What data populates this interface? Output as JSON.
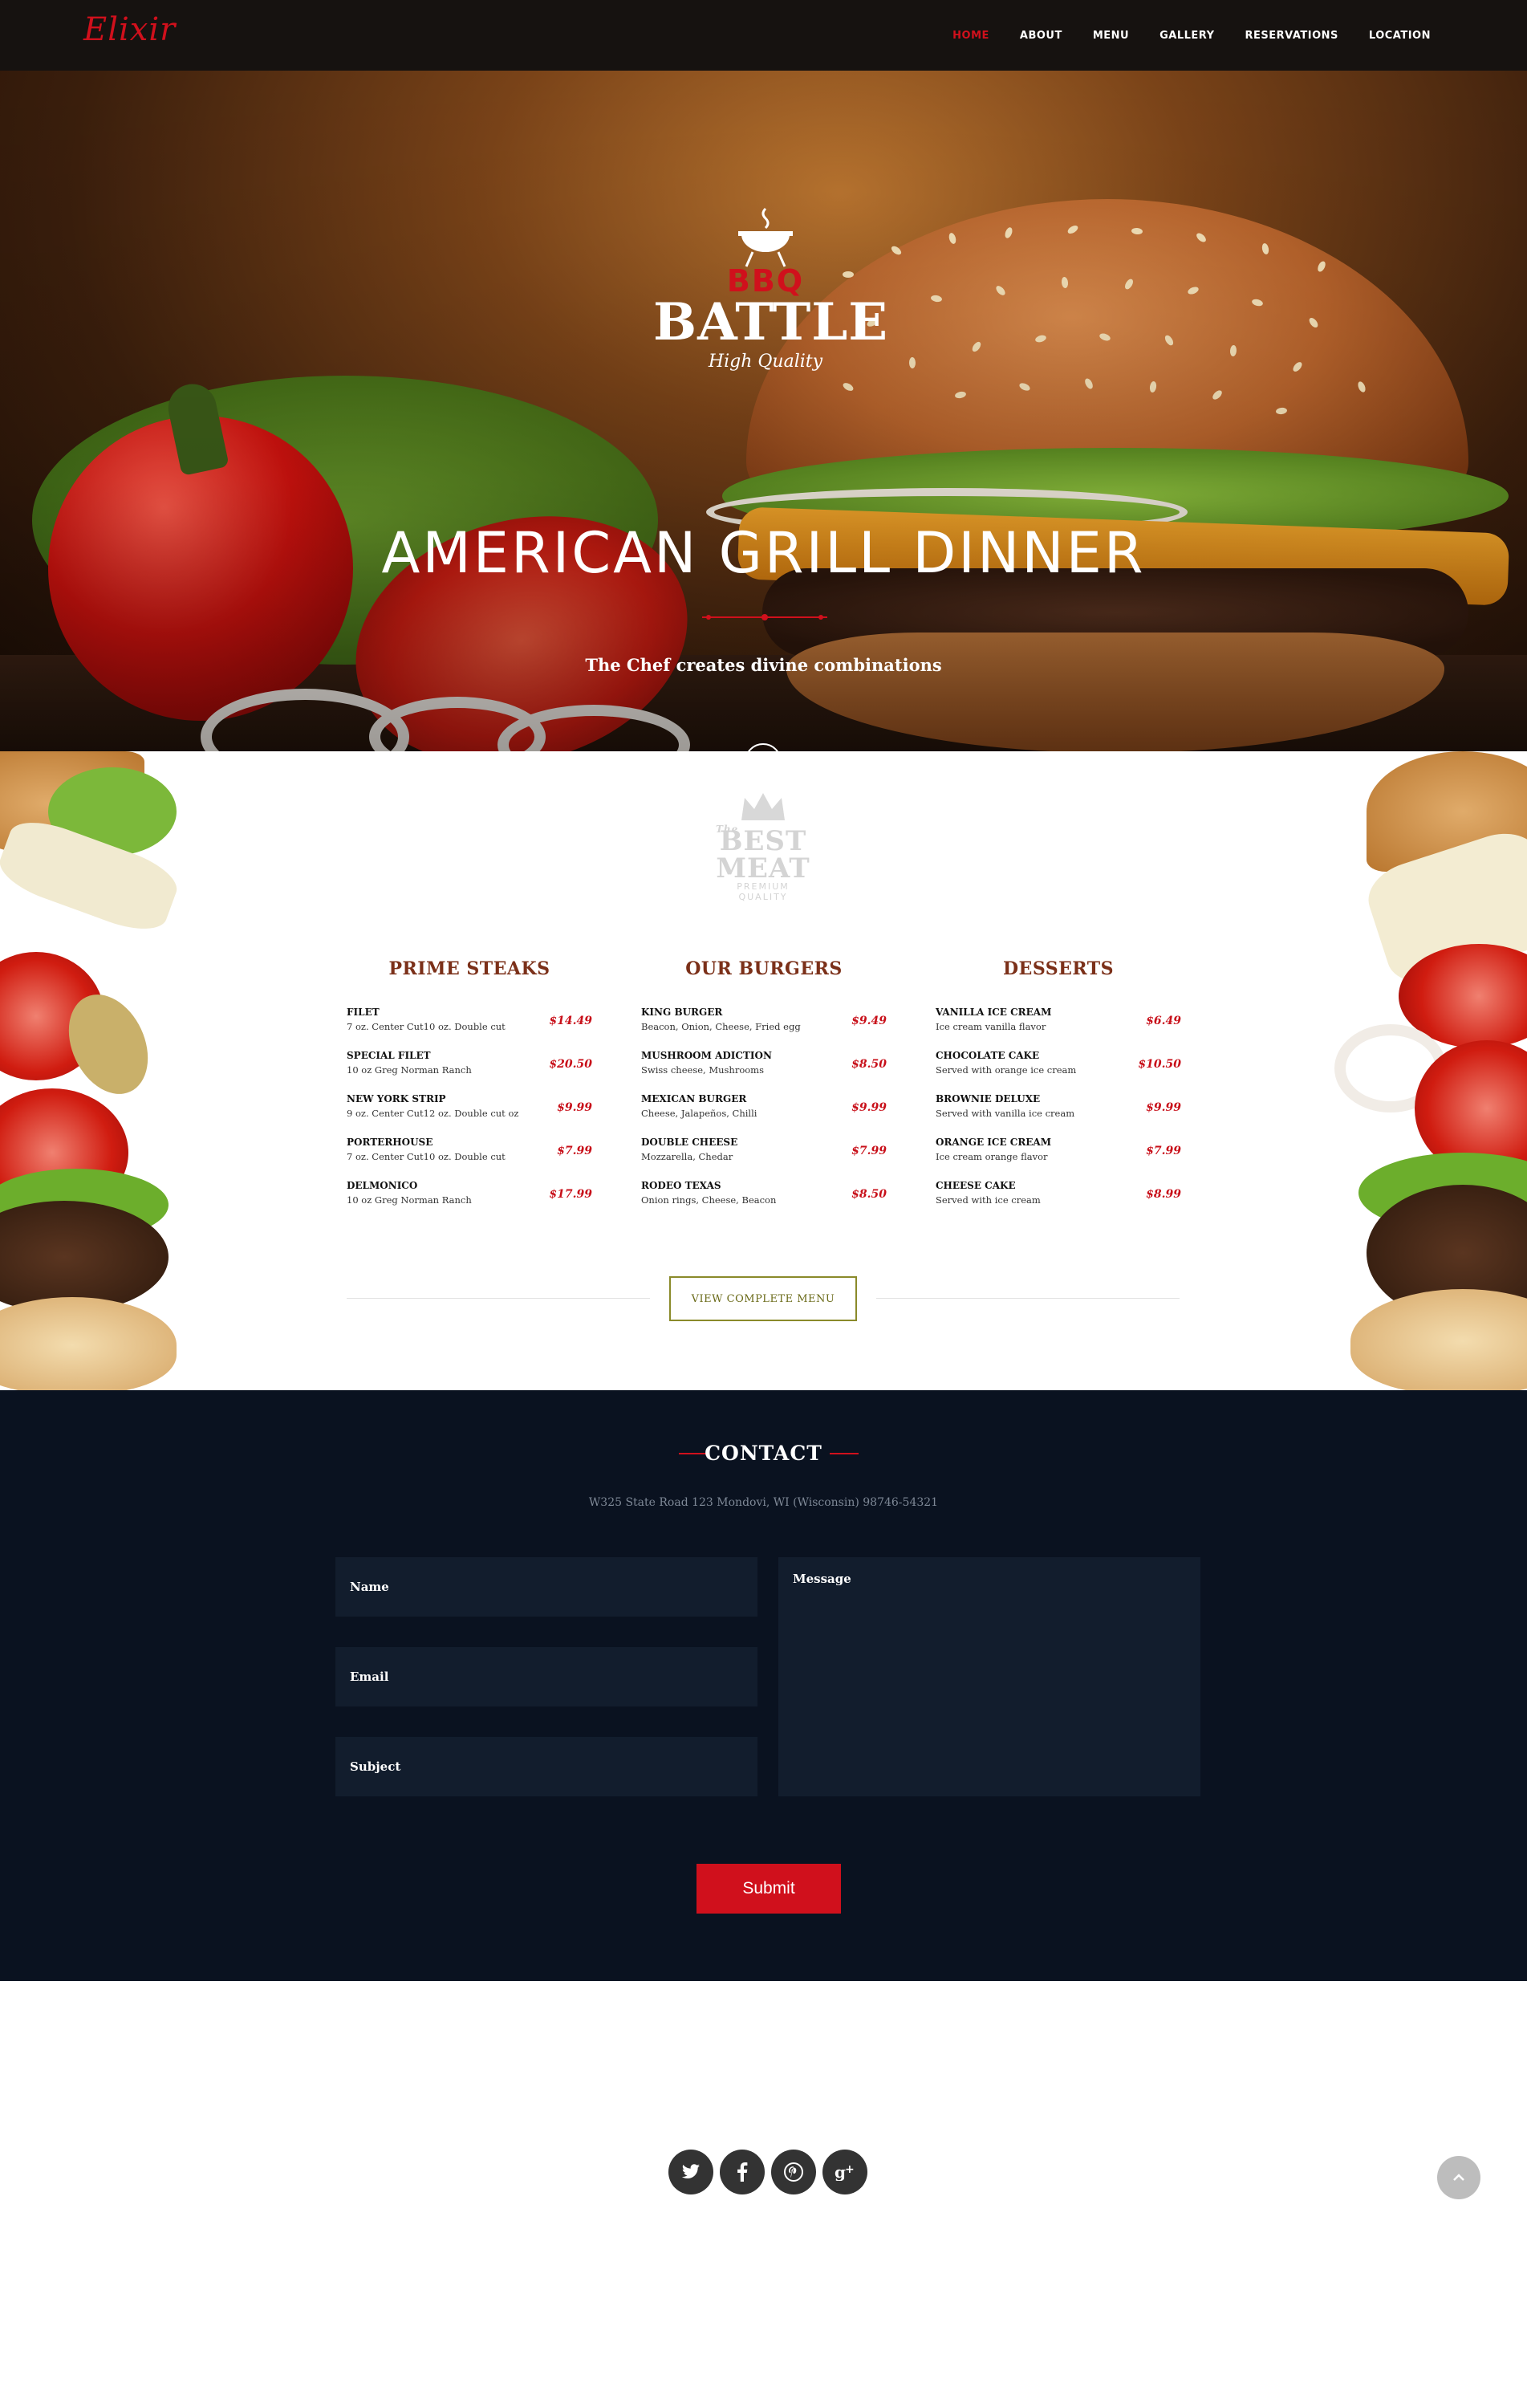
{
  "brand": {
    "logo": "Elixir",
    "accent": "#d0101c"
  },
  "nav": {
    "items": [
      {
        "label": "HOME",
        "active": true
      },
      {
        "label": "ABOUT"
      },
      {
        "label": "MENU"
      },
      {
        "label": "GALLERY"
      },
      {
        "label": "RESERVATIONS"
      },
      {
        "label": "LOCATION"
      }
    ]
  },
  "hero": {
    "badge_top": "BBQ",
    "badge_main": "BATTLE",
    "badge_tagline": "High Quality",
    "title": "AMERICAN GRILL DINNER",
    "subtitle": "The Chef creates divine combinations",
    "scroll_icon": "chevron-down-icon"
  },
  "menu": {
    "emblem": {
      "small_top": "The",
      "line1": "BEST",
      "line2": "MEAT",
      "small_bottom": "PREMIUM QUALITY"
    },
    "columns": [
      {
        "title": "PRIME STEAKS",
        "items": [
          {
            "name": "FILET",
            "desc": "7 oz. Center Cut10 oz. Double cut",
            "price": "$14.49"
          },
          {
            "name": "SPECIAL FILET",
            "desc": "10 oz Greg Norman Ranch",
            "price": "$20.50"
          },
          {
            "name": "NEW YORK STRIP",
            "desc": "9 oz. Center Cut12 oz. Double cut oz",
            "price": "$9.99"
          },
          {
            "name": "PORTERHOUSE",
            "desc": "7 oz. Center Cut10 oz. Double cut",
            "price": "$7.99"
          },
          {
            "name": "DELMONICO",
            "desc": "10 oz Greg Norman Ranch",
            "price": "$17.99"
          }
        ]
      },
      {
        "title": "OUR BURGERS",
        "items": [
          {
            "name": "KING BURGER",
            "desc": "Beacon, Onion, Cheese, Fried egg",
            "price": "$9.49"
          },
          {
            "name": "MUSHROOM ADICTION",
            "desc": "Swiss cheese, Mushrooms",
            "price": "$8.50"
          },
          {
            "name": "MEXICAN BURGER",
            "desc": "Cheese, Jalapeños, Chilli",
            "price": "$9.99"
          },
          {
            "name": "DOUBLE CHEESE",
            "desc": "Mozzarella, Chedar",
            "price": "$7.99"
          },
          {
            "name": "RODEO TEXAS",
            "desc": "Onion rings, Cheese, Beacon",
            "price": "$8.50"
          }
        ]
      },
      {
        "title": "DESSERTS",
        "items": [
          {
            "name": "VANILLA ICE CREAM",
            "desc": "Ice cream vanilla flavor",
            "price": "$6.49"
          },
          {
            "name": "CHOCOLATE CAKE",
            "desc": "Served with orange ice cream",
            "price": "$10.50"
          },
          {
            "name": "BROWNIE DELUXE",
            "desc": "Served with vanilla ice cream",
            "price": "$9.99"
          },
          {
            "name": "ORANGE ICE CREAM",
            "desc": "Ice cream orange flavor",
            "price": "$7.99"
          },
          {
            "name": "CHEESE CAKE",
            "desc": "Served with ice cream",
            "price": "$8.99"
          }
        ]
      }
    ],
    "view_button": "VIEW COMPLETE MENU"
  },
  "contact": {
    "title": "CONTACT",
    "address": "W325 State Road 123 Mondovi, WI (Wisconsin) 98746-54321",
    "name_placeholder": "Name",
    "email_placeholder": "Email",
    "subject_placeholder": "Subject",
    "message_placeholder": "Message",
    "submit": "Submit"
  },
  "footer": {
    "socials": [
      "twitter-icon",
      "facebook-icon",
      "pinterest-icon",
      "google-plus-icon"
    ],
    "back_to_top_icon": "chevron-up-icon"
  }
}
